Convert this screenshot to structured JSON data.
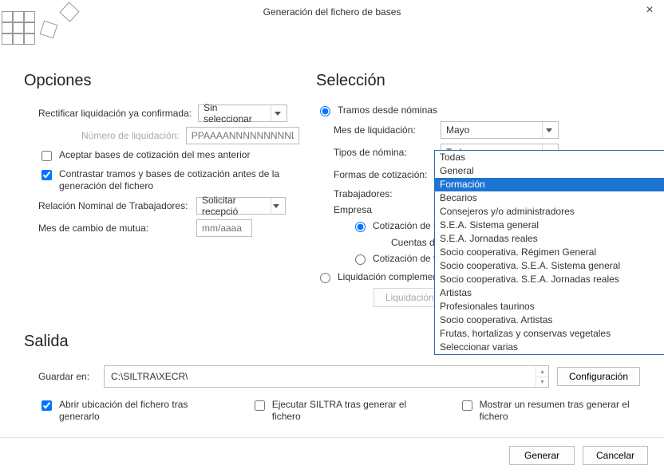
{
  "window": {
    "title": "Generación del fichero de bases"
  },
  "opciones": {
    "heading": "Opciones",
    "rectificar_label": "Rectificar liquidación ya confirmada:",
    "rectificar_value": "Sin seleccionar",
    "num_liq_label": "Número de liquidación:",
    "num_liq_placeholder": "PPAAAANNNNNNNNNDC",
    "chk_aceptar": "Aceptar bases de cotización del mes anterior",
    "chk_contrastar": "Contrastar tramos y bases de cotización antes de la generación del fichero",
    "rnt_label": "Relación Nominal de Trabajadores:",
    "rnt_value": "Solicitar recepció",
    "mes_cambio_label": "Mes de cambio de mutua:",
    "mes_cambio_placeholder": "mm/aaaa"
  },
  "seleccion": {
    "heading": "Selección",
    "rad_tramos": "Tramos desde nóminas",
    "mes_liq_label": "Mes de liquidación:",
    "mes_liq_value": "Mayo",
    "tipos_label": "Tipos de nómina:",
    "tipos_value": "Todas",
    "formas_label": "Formas de cotización:",
    "formas_value": "Formación",
    "dropdown_options": [
      "Todas",
      "General",
      "Formación",
      "Becarios",
      "Consejeros y/o administradores",
      "S.E.A. Sistema general",
      "S.E.A. Jornadas reales",
      "Socio cooperativa. Régimen General",
      "Socio cooperativa. S.E.A. Sistema general",
      "Socio cooperativa. S.E.A. Jornadas reales",
      "Artistas",
      "Profesionales taurinos",
      "Socio cooperativa. Artistas",
      "Frutas, hortalizas y conservas vegetales",
      "Seleccionar varias"
    ],
    "dropdown_selected_index": 2,
    "trabajadores_label": "Trabajadores:",
    "empresa_label": "Empresa",
    "rad_cot_empresa": "Cotización de la e",
    "cuentas_label": "Cuentas de cotiz",
    "rad_cot_varias": "Cotización de var",
    "rad_liq_compl": "Liquidación complement",
    "liq_btn": "Liquidación:"
  },
  "salida": {
    "heading": "Salida",
    "guardar_label": "Guardar en:",
    "path_value": "C:\\SILTRA\\XECR\\",
    "config_btn": "Configuración",
    "chk_abrir": "Abrir ubicación del fichero tras generarlo",
    "chk_ejecutar": "Ejecutar SILTRA tras generar el fichero",
    "chk_mostrar": "Mostrar un resumen tras generar el fichero"
  },
  "footer": {
    "generar": "Generar",
    "cancelar": "Cancelar"
  }
}
